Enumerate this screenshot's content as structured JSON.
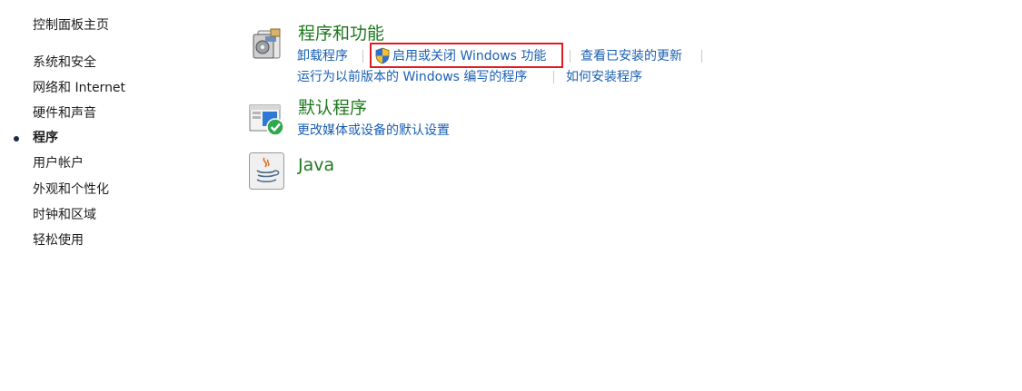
{
  "nav": {
    "home": "控制面板主页",
    "items": [
      {
        "label": "系统和安全"
      },
      {
        "label": "网络和 Internet"
      },
      {
        "label": "硬件和声音"
      },
      {
        "label": "程序",
        "current": true
      },
      {
        "label": "用户帐户"
      },
      {
        "label": "外观和个性化"
      },
      {
        "label": "时钟和区域"
      },
      {
        "label": "轻松使用"
      }
    ]
  },
  "categories": {
    "programs": {
      "title": "程序和功能",
      "icon": "programs-features-icon",
      "links": {
        "uninstall": "卸载程序",
        "windows_features": "启用或关闭 Windows 功能",
        "installed_updates": "查看已安装的更新",
        "compat": "运行为以前版本的 Windows 编写的程序",
        "how_install": "如何安装程序"
      },
      "shield_icon": "uac-shield-icon"
    },
    "defaults": {
      "title": "默认程序",
      "icon": "default-programs-icon",
      "links": {
        "media_defaults": "更改媒体或设备的默认设置"
      }
    },
    "java": {
      "title": "Java",
      "icon": "java-cup-icon"
    }
  },
  "colors": {
    "category_title": "#1e7a1e",
    "link": "#1a5fb4",
    "highlight": "#e01b24"
  }
}
